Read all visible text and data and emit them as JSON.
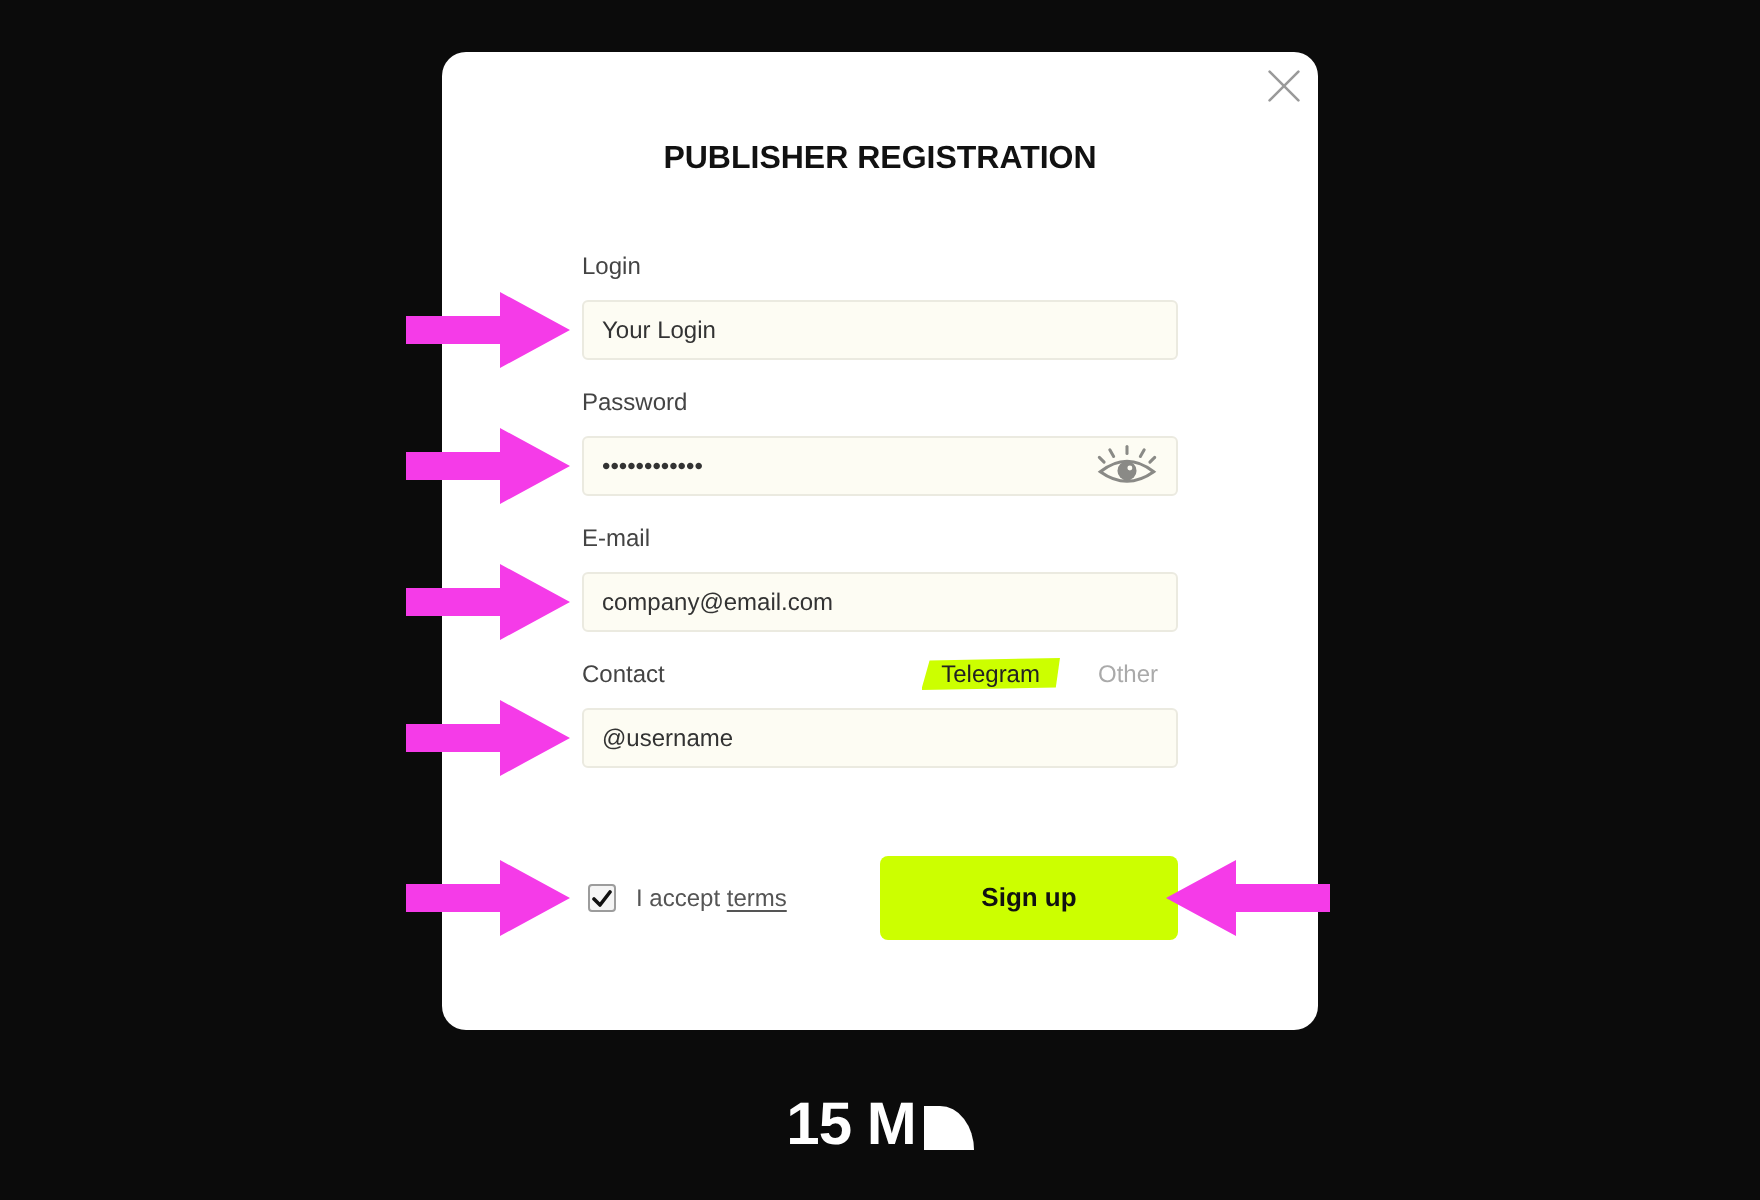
{
  "dialog": {
    "title": "PUBLISHER REGISTRATION",
    "fields": [
      {
        "kind": "text",
        "label": "Login",
        "placeholder": "Your Login",
        "marker_arrow": true
      },
      {
        "kind": "password",
        "label": "Password",
        "value": "••••••••••••",
        "marker_arrow": true
      },
      {
        "kind": "text",
        "label": "E-mail",
        "placeholder": "company@email.com",
        "marker_arrow": true
      },
      {
        "kind": "contact",
        "label": "Contact",
        "tabs": [
          {
            "label": "Telegram",
            "selected": true
          },
          {
            "label": "Other",
            "selected": false
          }
        ],
        "placeholder": "@username",
        "marker_arrow": true
      }
    ],
    "terms": {
      "text": "I accept",
      "link": "terms",
      "checked": true,
      "marker_arrow": true
    },
    "submit": {
      "label": "Sign up",
      "marker_arrow": true
    }
  },
  "logo": {
    "text": "15 M"
  }
}
